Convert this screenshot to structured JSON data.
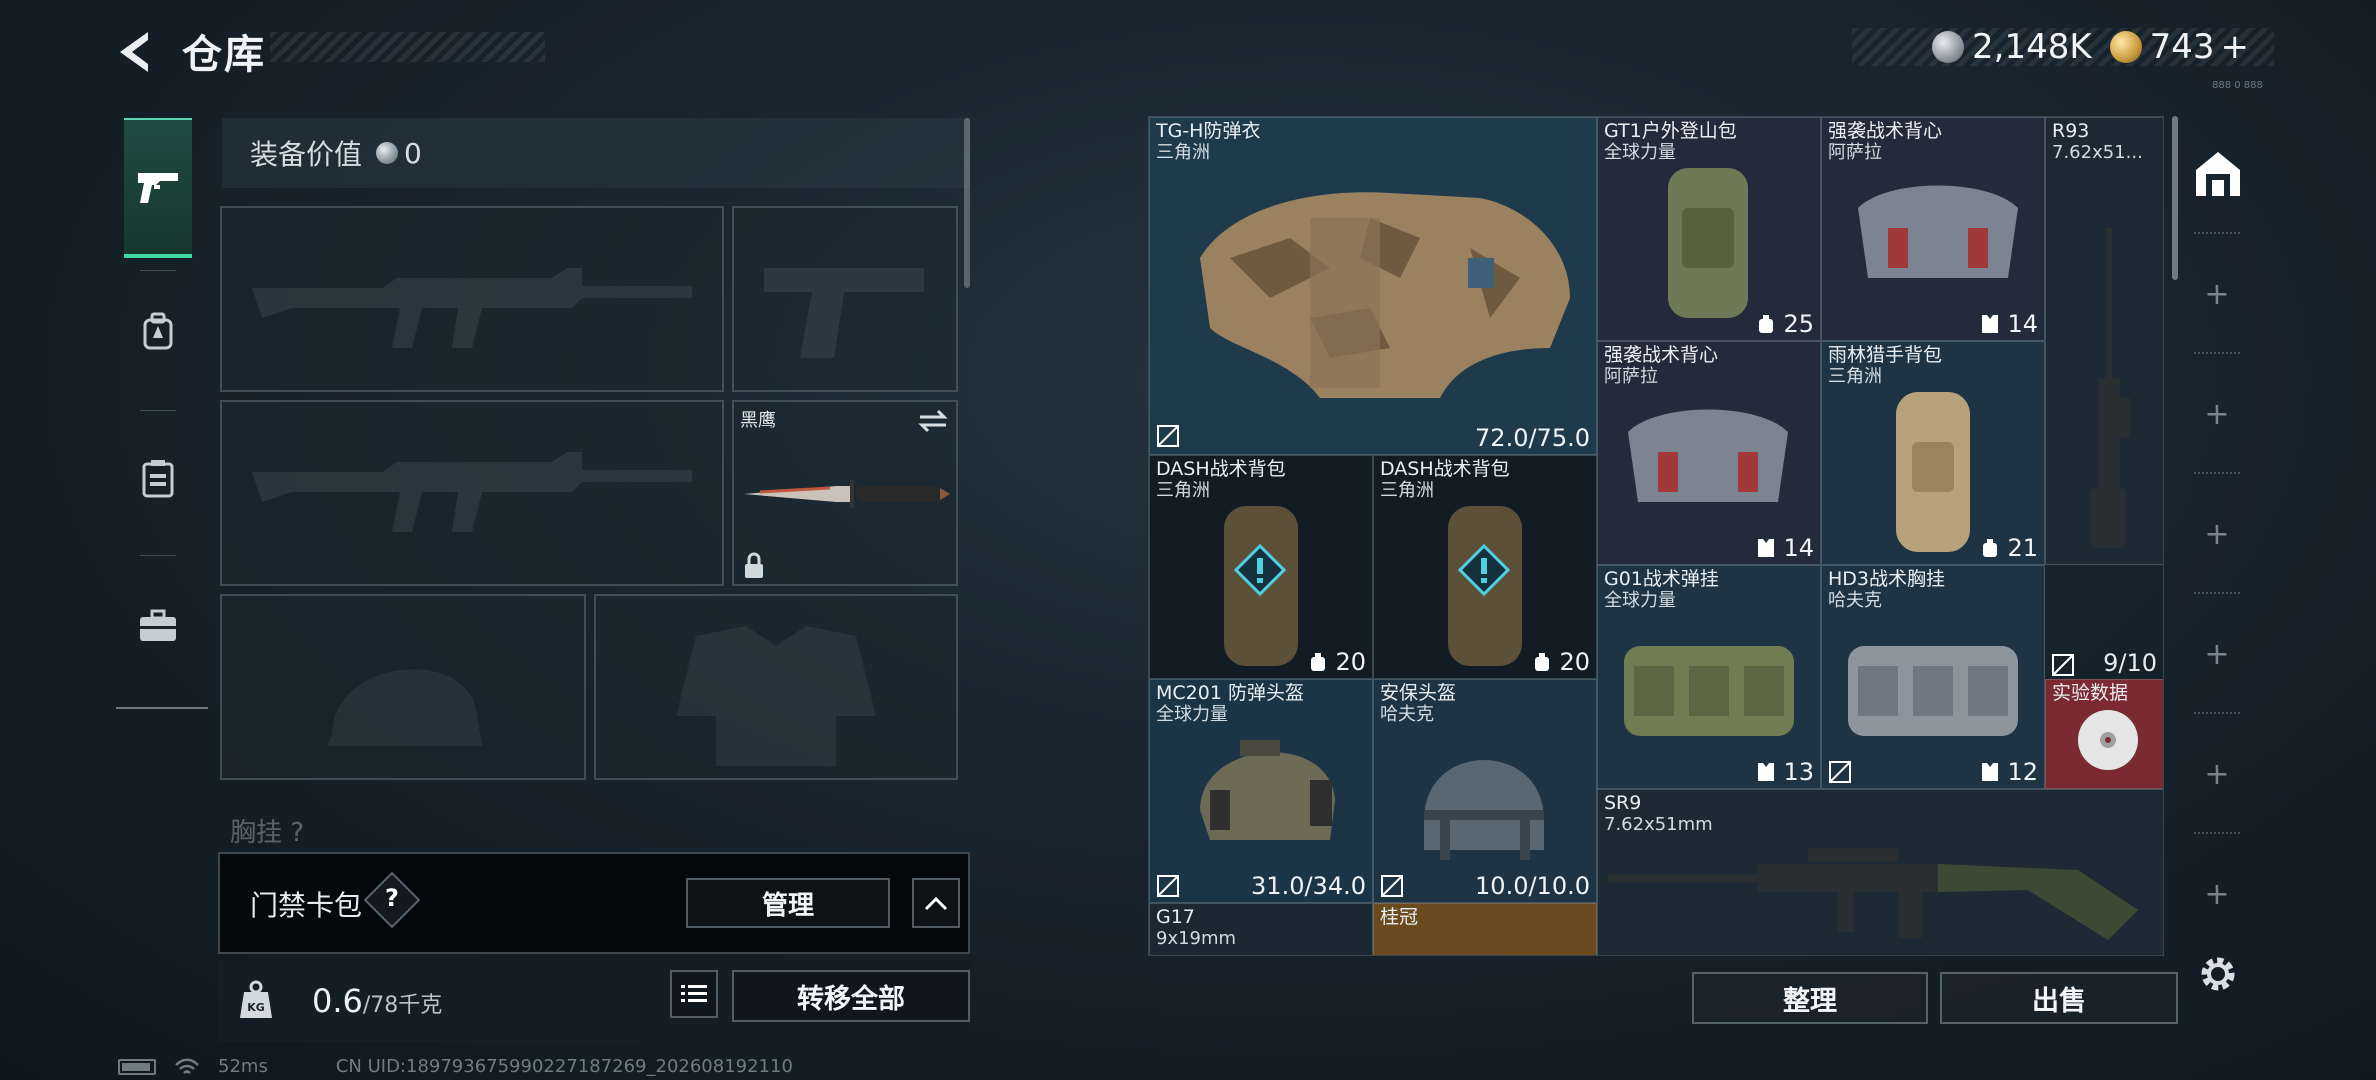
{
  "header": {
    "title": "仓库",
    "silver_amount": "2,148K",
    "gold_amount": "743",
    "gold_plus": "+",
    "version": "888 0 888"
  },
  "equipment": {
    "value_label": "装备价值",
    "value": "0",
    "melee_name": "黑鹰",
    "partial_label": "胸挂 ?",
    "card_pack_label": "门禁卡包",
    "card_pack_help": "?",
    "manage_label": "管理",
    "weight_value": "0.6",
    "weight_cap": "/78千克",
    "transfer_all_label": "转移全部"
  },
  "inventory": {
    "items": [
      {
        "name": "TG-H防弹衣",
        "sub": "三角洲",
        "stat": "72.0/75.0"
      },
      {
        "name": "GT1户外登山包",
        "sub": "全球力量",
        "stat": "25"
      },
      {
        "name": "强袭战术背心",
        "sub": "阿萨拉",
        "stat": "14"
      },
      {
        "name": "R93",
        "sub": "7.62x51...",
        "stat": ""
      },
      {
        "name": "DASH战术背包",
        "sub": "三角洲",
        "stat": "20"
      },
      {
        "name": "DASH战术背包",
        "sub": "三角洲",
        "stat": "20"
      },
      {
        "name": "强袭战术背心",
        "sub": "阿萨拉",
        "stat": "14"
      },
      {
        "name": "雨林猎手背包",
        "sub": "三角洲",
        "stat": "21"
      },
      {
        "name": "G01战术弹挂",
        "sub": "全球力量",
        "stat": "13"
      },
      {
        "name": "HD3战术胸挂",
        "sub": "哈夫克",
        "stat": "12"
      },
      {
        "name": "",
        "sub": "",
        "stat": "9/10"
      },
      {
        "name": "实验数据",
        "sub": "",
        "stat": ""
      },
      {
        "name": "MC201 防弹头盔",
        "sub": "全球力量",
        "stat": "31.0/34.0"
      },
      {
        "name": "安保头盔",
        "sub": "哈夫克",
        "stat": "10.0/10.0"
      },
      {
        "name": "SR9",
        "sub": "7.62x51mm",
        "stat": ""
      },
      {
        "name": "G17",
        "sub": "9x19mm",
        "stat": ""
      },
      {
        "name": "桂冠",
        "sub": "",
        "stat": ""
      }
    ],
    "sort_label": "整理",
    "sell_label": "出售"
  },
  "footer": {
    "ping": "52ms",
    "uid": "CN UID:1897936759902271872​69_202608192110"
  },
  "colors": {
    "accent_green": "#3fd9a4",
    "gold_item_bg": "#6b4a1f",
    "red_item_bg": "#7a2a30"
  }
}
